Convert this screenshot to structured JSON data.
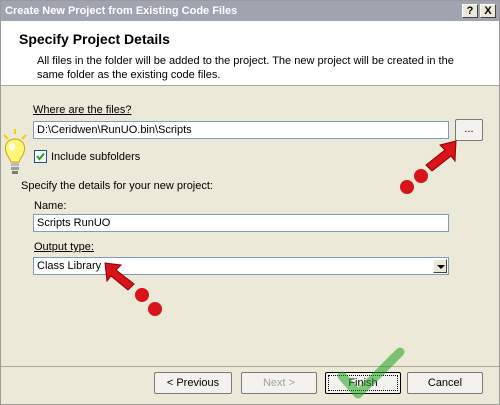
{
  "window": {
    "title": "Create New Project from Existing Code Files",
    "help_button": "?",
    "close_button": "X"
  },
  "header": {
    "title": "Specify Project Details",
    "description": "All files in the folder will be added to the project.  The new project will be created in the same folder as the existing code files."
  },
  "form": {
    "files_label": "Where are the files?",
    "files_value": "D:\\Ceridwen\\RunUO.bin\\Scripts",
    "browse_label": "...",
    "include_subfolders_label": "Include subfolders",
    "include_subfolders_checked": true,
    "details_label": "Specify the details for your new project:",
    "name_label": "Name:",
    "name_value": "Scripts RunUO",
    "output_type_label": "Output type:",
    "output_type_value": "Class Library"
  },
  "buttons": {
    "previous": "< Previous",
    "next": "Next >",
    "finish": "Finish",
    "cancel": "Cancel"
  },
  "colors": {
    "arrow_red": "#d8141a",
    "check_green": "#21a121",
    "title_bar": "#9fa4b0"
  },
  "icons": [
    "lightbulb-icon",
    "checkmark-icon",
    "red-arrow-icon",
    "dropdown-arrow-icon"
  ]
}
